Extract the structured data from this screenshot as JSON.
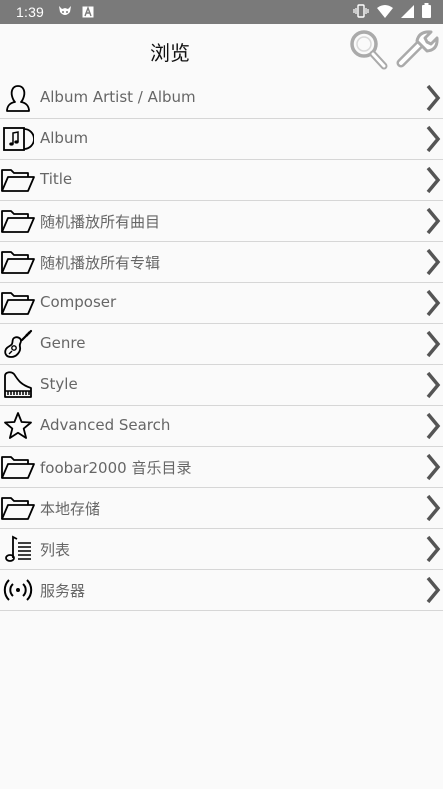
{
  "status_bar": {
    "time": "1:39",
    "left_icons": [
      "firefox-fox-icon",
      "font-a-icon"
    ],
    "right_icons": [
      "vibrate-icon",
      "wifi-icon",
      "signal-icon",
      "battery-icon"
    ]
  },
  "header": {
    "title": "浏览",
    "actions": [
      "search-icon",
      "wrench-icon"
    ]
  },
  "menu": [
    {
      "icon": "person-icon",
      "label": "Album Artist / Album"
    },
    {
      "icon": "album-icon",
      "label": "Album"
    },
    {
      "icon": "folder-icon",
      "label": "Title"
    },
    {
      "icon": "folder-icon",
      "label": "随机播放所有曲目"
    },
    {
      "icon": "folder-icon",
      "label": "随机播放所有专辑"
    },
    {
      "icon": "folder-icon",
      "label": "Composer"
    },
    {
      "icon": "guitar-icon",
      "label": "Genre"
    },
    {
      "icon": "piano-icon",
      "label": "Style"
    },
    {
      "icon": "star-icon",
      "label": "Advanced Search"
    },
    {
      "icon": "folder-icon",
      "label": "foobar2000 音乐目录"
    },
    {
      "icon": "folder-icon",
      "label": "本地存储"
    },
    {
      "icon": "playlist-icon",
      "label": "列表"
    },
    {
      "icon": "server-icon",
      "label": "服务器"
    }
  ],
  "colors": {
    "status_bar": "#7a7a7a",
    "background": "#fafafa",
    "label_text": "#666666",
    "divider": "#d6d6d6",
    "chevron": "#555555"
  }
}
